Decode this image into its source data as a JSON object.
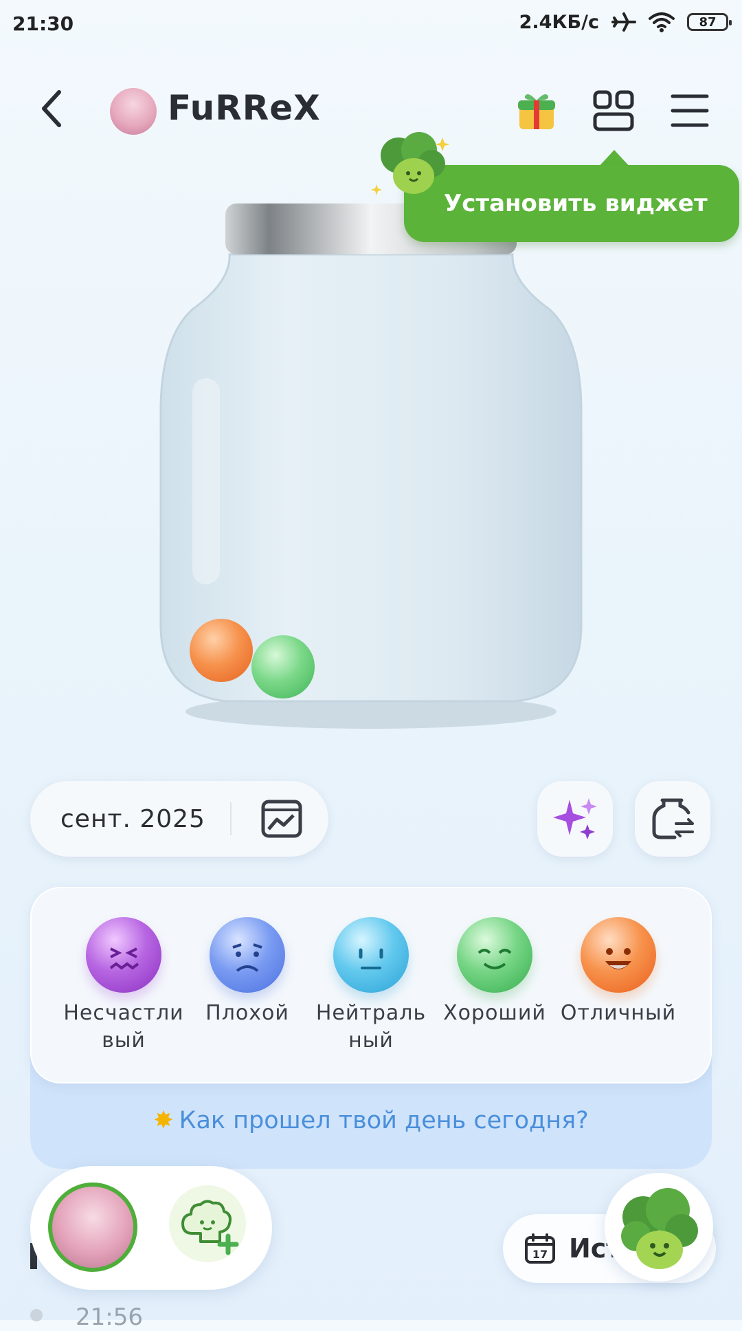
{
  "status_bar": {
    "time": "21:30",
    "net_speed": "2.4КБ/с",
    "battery": "87"
  },
  "header": {
    "user_name": "FuRReX"
  },
  "tooltip": {
    "text": "Установить виджет"
  },
  "jar": {
    "balls": [
      {
        "mood": "Отличный",
        "color": "#f47a3a"
      },
      {
        "mood": "Хороший",
        "color": "#5ccb6a"
      }
    ]
  },
  "controls": {
    "month": "сент. 2025"
  },
  "moods": [
    {
      "label": "Несчастливый",
      "color": "#a24ad0",
      "icon": "sad-face-icon"
    },
    {
      "label": "Плохой",
      "color": "#5b82ef",
      "icon": "worried-face-icon"
    },
    {
      "label": "Нейтральный",
      "color": "#40b6e4",
      "icon": "neutral-face-icon"
    },
    {
      "label": "Хороший",
      "color": "#4fc566",
      "icon": "smile-face-icon"
    },
    {
      "label": "Отличный",
      "color": "#f5783a",
      "icon": "grin-face-icon"
    }
  ],
  "prompt": {
    "text": "Как прошел твой день сегодня?"
  },
  "bottom": {
    "history_label": "Ист",
    "calendar_day": "17",
    "peek_time": "21:56"
  },
  "colors": {
    "accent_green": "#5cb33a",
    "prompt_blue": "#4a8fdb"
  }
}
